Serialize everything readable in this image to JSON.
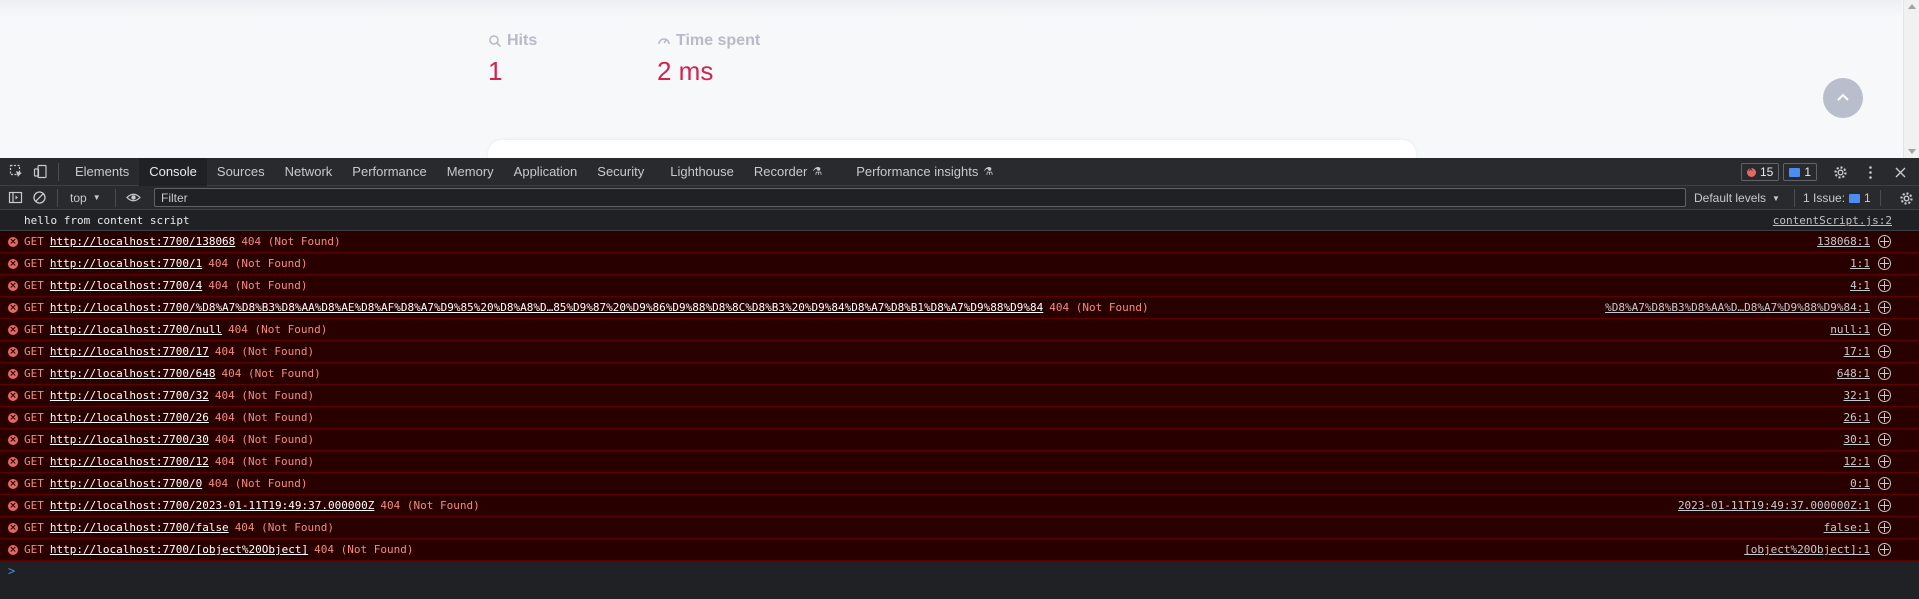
{
  "page": {
    "hits_label": "Hits",
    "hits_value": "1",
    "time_label": "Time spent",
    "time_value": "2 ms"
  },
  "devtools": {
    "tabs": [
      {
        "label": "Elements"
      },
      {
        "label": "Console"
      },
      {
        "label": "Sources"
      },
      {
        "label": "Network"
      },
      {
        "label": "Performance"
      },
      {
        "label": "Memory"
      },
      {
        "label": "Application"
      },
      {
        "label": "Security"
      },
      {
        "label": "Lighthouse"
      },
      {
        "label": "Recorder"
      },
      {
        "label": "Performance insights"
      }
    ],
    "active_tab": "Console",
    "error_count": "15",
    "message_count": "1",
    "toolbar": {
      "context": "top",
      "filter_placeholder": "Filter",
      "levels": "Default levels",
      "issues_label": "1 Issue:",
      "issues_count": "1"
    },
    "log": {
      "text": "hello from content script",
      "source": "contentScript.js:2"
    },
    "errors": [
      {
        "method": "GET",
        "url": "http://localhost:7700/138068",
        "status": "404 (Not Found)",
        "source": "138068:1"
      },
      {
        "method": "GET",
        "url": "http://localhost:7700/1",
        "status": "404 (Not Found)",
        "source": "1:1"
      },
      {
        "method": "GET",
        "url": "http://localhost:7700/4",
        "status": "404 (Not Found)",
        "source": "4:1"
      },
      {
        "method": "GET",
        "url": "http://localhost:7700/%D8%A7%D8%B3%D8%AA%D8%AE%D8%AF%D8%A7%D9%85%20%D8%A8%D…85%D9%87%20%D9%86%D9%88%D8%8C%D8%B3%20%D9%84%D8%A7%D8%B1%D8%A7%D9%88%D9%84",
        "status": "404 (Not Found)",
        "source": "%D8%A7%D8%B3%D8%AA%D…D8%A7%D9%88%D9%84:1"
      },
      {
        "method": "GET",
        "url": "http://localhost:7700/null",
        "status": "404 (Not Found)",
        "source": "null:1"
      },
      {
        "method": "GET",
        "url": "http://localhost:7700/17",
        "status": "404 (Not Found)",
        "source": "17:1"
      },
      {
        "method": "GET",
        "url": "http://localhost:7700/648",
        "status": "404 (Not Found)",
        "source": "648:1"
      },
      {
        "method": "GET",
        "url": "http://localhost:7700/32",
        "status": "404 (Not Found)",
        "source": "32:1"
      },
      {
        "method": "GET",
        "url": "http://localhost:7700/26",
        "status": "404 (Not Found)",
        "source": "26:1"
      },
      {
        "method": "GET",
        "url": "http://localhost:7700/30",
        "status": "404 (Not Found)",
        "source": "30:1"
      },
      {
        "method": "GET",
        "url": "http://localhost:7700/12",
        "status": "404 (Not Found)",
        "source": "12:1"
      },
      {
        "method": "GET",
        "url": "http://localhost:7700/0",
        "status": "404 (Not Found)",
        "source": "0:1"
      },
      {
        "method": "GET",
        "url": "http://localhost:7700/2023-01-11T19:49:37.000000Z",
        "status": "404 (Not Found)",
        "source": "2023-01-11T19:49:37.000000Z:1"
      },
      {
        "method": "GET",
        "url": "http://localhost:7700/false",
        "status": "404 (Not Found)",
        "source": "false:1"
      },
      {
        "method": "GET",
        "url": "http://localhost:7700/[object%20Object]",
        "status": "404 (Not Found)",
        "source": "[object%20Object]:1"
      }
    ],
    "prompt": ">"
  }
}
